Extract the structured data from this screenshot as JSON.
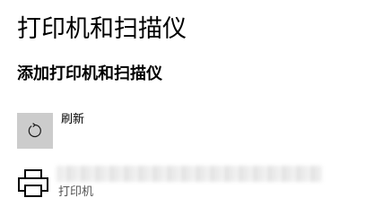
{
  "page": {
    "title": "打印机和扫描仪"
  },
  "add_section": {
    "title": "添加打印机和扫描仪",
    "refresh_label": "刷新",
    "refresh_icon": "refresh-icon"
  },
  "devices": [
    {
      "name": "",
      "type_label": "打印机",
      "icon": "printer-icon"
    }
  ],
  "colors": {
    "refresh_tile_bg": "#cccccc",
    "secondary_text": "#555555"
  }
}
